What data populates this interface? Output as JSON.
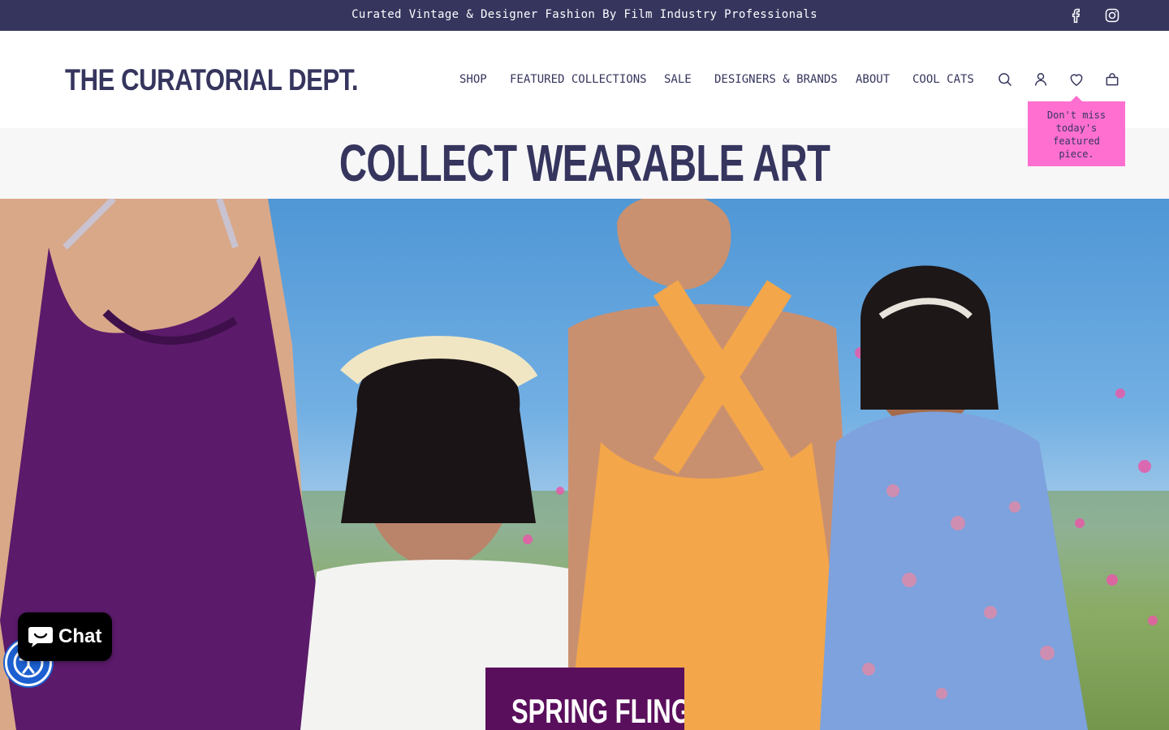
{
  "announcement": {
    "text": "Curated Vintage & Designer Fashion By Film Industry Professionals",
    "social": [
      {
        "icon": "facebook-icon"
      },
      {
        "icon": "instagram-icon"
      }
    ]
  },
  "header": {
    "logo": "THE CURATORIAL DEPT.",
    "nav": [
      "SHOP",
      "FEATURED COLLECTIONS",
      "SALE",
      "DESIGNERS & BRANDS",
      "ABOUT",
      "COOL CATS"
    ],
    "icons": [
      "search-icon",
      "account-icon",
      "wishlist-heart-icon",
      "cart-bag-icon"
    ]
  },
  "tooltip": {
    "text": "Don't miss today's featured piece."
  },
  "tagline": "COLLECT WEARABLE ART",
  "hero": {
    "cta_label": "SPRING FLING"
  },
  "chat": {
    "label": "Chat"
  },
  "colors": {
    "brand_navy": "#35355e",
    "tooltip_pink": "#ff6fd0",
    "cta_purple": "#5a0f5c",
    "accessibility_blue": "#1b5fd0"
  }
}
